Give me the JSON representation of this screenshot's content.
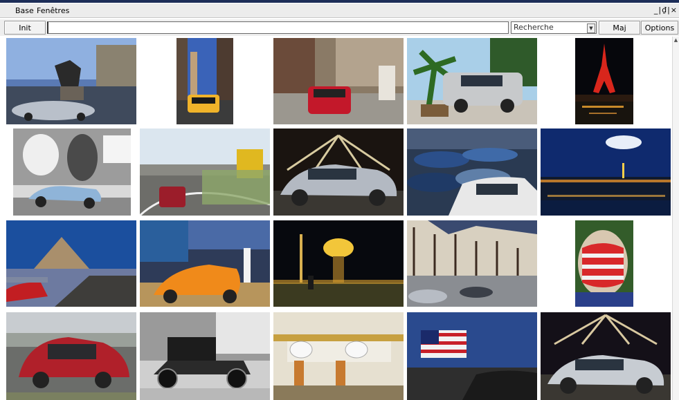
{
  "menubar": {
    "items": [
      "Base",
      "Fenêtres"
    ],
    "window_controls": "_|₫|×"
  },
  "toolbar": {
    "init_label": "Init",
    "search_value": "",
    "search_mode": "Recherche",
    "refresh_label": "Maj",
    "options_label": "Options"
  },
  "gallery": {
    "rows": [
      [
        "horse-statue-grey-sedan",
        "taxi-city-street",
        "red-car-town-square",
        "silver-suv-palm-tree",
        "eiffel-tower-night"
      ],
      [
        "blue-convertible-mural",
        "red-car-highway-interchange",
        "silver-car-ferris-wheel",
        "parking-lot-cars",
        "paris-skyline-night"
      ],
      [
        "mont-saint-michel-cars",
        "orange-sports-car",
        "golden-flame-monument",
        "half-timbered-houses",
        "flag-painted-face"
      ],
      [
        "red-hatchback",
        "vintage-black-car",
        "gas-station",
        "american-flag-car",
        "car-under-ferris-wheel"
      ]
    ]
  }
}
